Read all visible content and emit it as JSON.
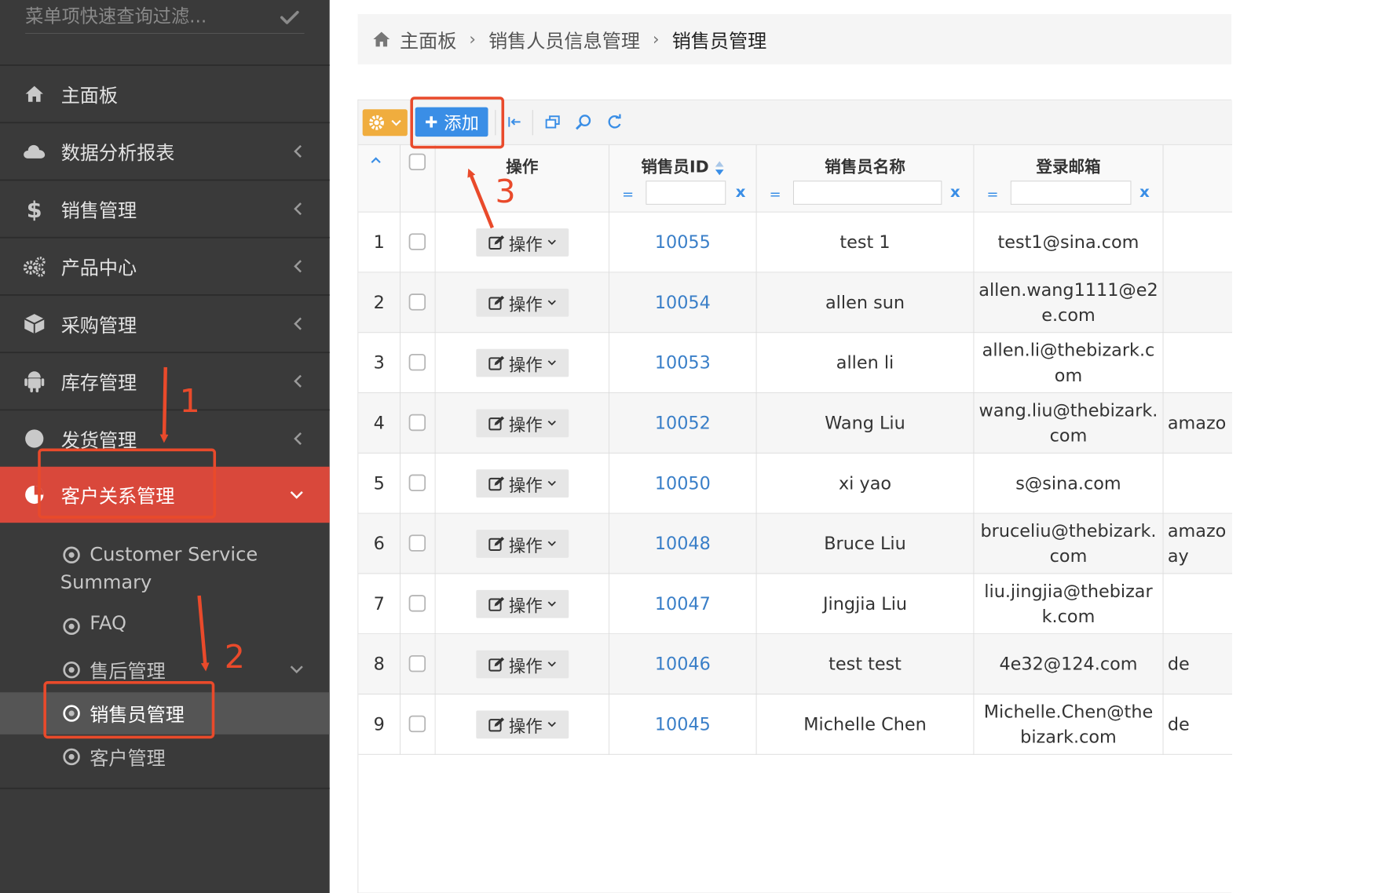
{
  "sidebar": {
    "filter_placeholder": "菜单项快速查询过滤...",
    "menu": [
      {
        "label": "主面板",
        "icon": "home-icon"
      },
      {
        "label": "数据分析报表",
        "icon": "cloud-icon"
      },
      {
        "label": "销售管理",
        "icon": "dollar-icon"
      },
      {
        "label": "产品中心",
        "icon": "gears-icon"
      },
      {
        "label": "采购管理",
        "icon": "cube-icon"
      },
      {
        "label": "库存管理",
        "icon": "android-icon"
      },
      {
        "label": "发货管理",
        "icon": "circle-icon"
      },
      {
        "label": "客户关系管理",
        "icon": "pie-icon"
      }
    ],
    "submenu": [
      {
        "label": "Customer Service Summary"
      },
      {
        "label": "FAQ"
      },
      {
        "label": "售后管理"
      },
      {
        "label": "销售员管理"
      },
      {
        "label": "客户管理"
      }
    ]
  },
  "breadcrumb": [
    "主面板",
    "销售人员信息管理",
    "销售员管理"
  ],
  "toolbar": {
    "add_label": "添加"
  },
  "table": {
    "headers": {
      "op": "操作",
      "id": "销售员ID",
      "name": "销售员名称",
      "email": "登录邮箱"
    },
    "filter_eq": "=",
    "filter_clear": "x",
    "op_label": "操作",
    "rows": [
      {
        "index": "1",
        "id": "10055",
        "name": "test 1",
        "email": "test1@sina.com",
        "extra": ""
      },
      {
        "index": "2",
        "id": "10054",
        "name": "allen sun",
        "email": "allen.wang1111@e2e.com",
        "extra": ""
      },
      {
        "index": "3",
        "id": "10053",
        "name": "allen li",
        "email": "allen.li@thebizark.com",
        "extra": ""
      },
      {
        "index": "4",
        "id": "10052",
        "name": "Wang Liu",
        "email": "wang.liu@thebizark.com",
        "extra": "amazo"
      },
      {
        "index": "5",
        "id": "10050",
        "name": "xi yao",
        "email": "s@sina.com",
        "extra": ""
      },
      {
        "index": "6",
        "id": "10048",
        "name": "Bruce Liu",
        "email": "bruceliu@thebizark.com",
        "extra": "amazo ay"
      },
      {
        "index": "7",
        "id": "10047",
        "name": "Jingjia Liu",
        "email": "liu.jingjia@thebizark.com",
        "extra": ""
      },
      {
        "index": "8",
        "id": "10046",
        "name": "test test",
        "email": "4e32@124.com",
        "extra": "de"
      },
      {
        "index": "9",
        "id": "10045",
        "name": "Michelle Chen",
        "email": "Michelle.Chen@thebizark.com",
        "extra": "de"
      }
    ]
  },
  "annotations": [
    "1",
    "2",
    "3"
  ],
  "colors": {
    "accent_red": "#d9483b",
    "annotation_red": "#e94a2b",
    "primary_blue": "#3a8ee6",
    "warning_orange": "#f0ad3e",
    "sidebar_bg": "#3a3a3a"
  }
}
